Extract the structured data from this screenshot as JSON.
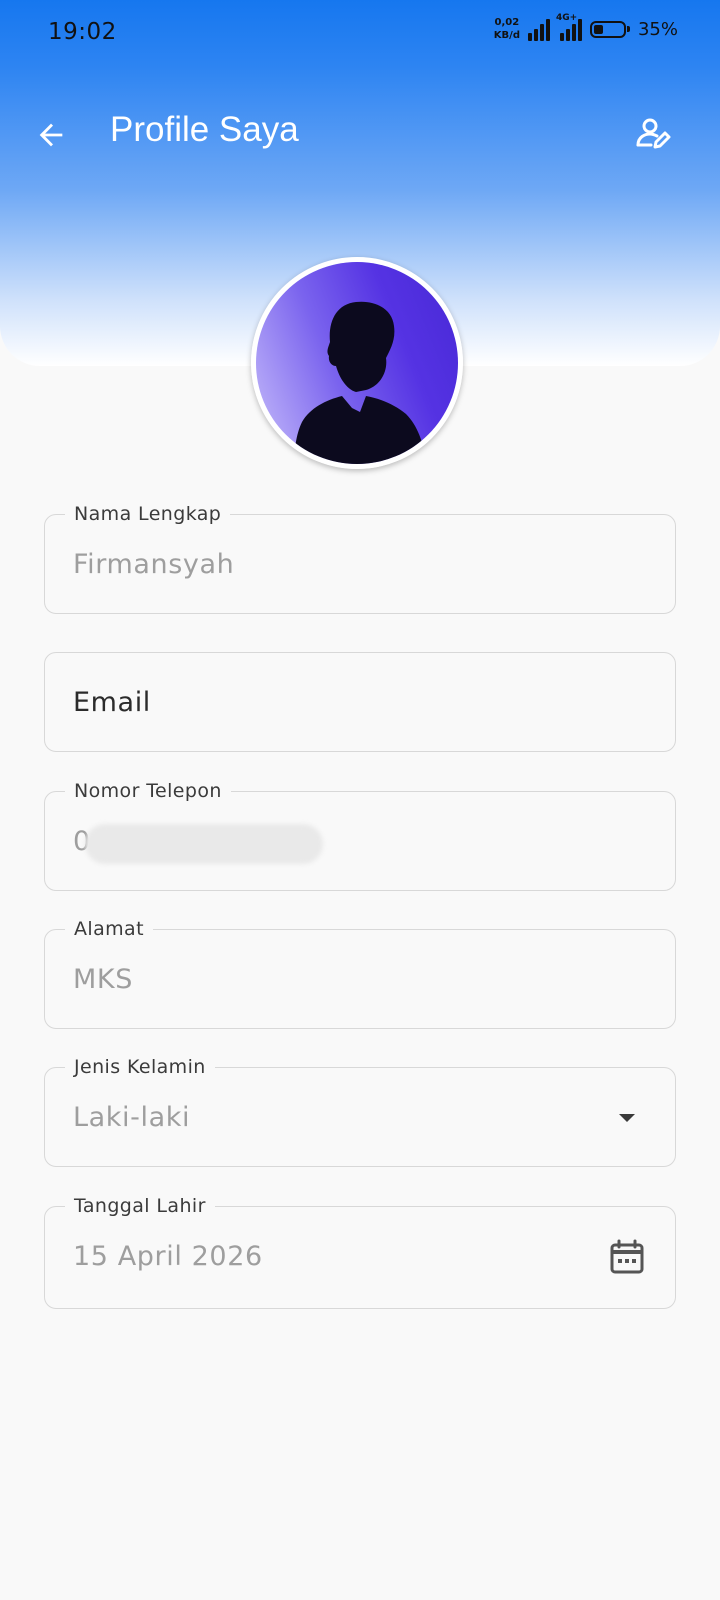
{
  "status_bar": {
    "time": "19:02",
    "net_speed_value": "0,02",
    "net_speed_unit": "KB/d",
    "network_type": "4G+",
    "battery_percent": "35%",
    "battery_level": 0.35,
    "icons": [
      "signal-icon",
      "signal-4g-icon",
      "battery-icon"
    ]
  },
  "app_bar": {
    "title": "Profile Saya",
    "back_icon": "arrow-left-icon",
    "edit_icon": "edit-user-icon"
  },
  "colors": {
    "header_gradient_top": "#1677ef",
    "header_gradient_bottom": "#ffffff",
    "background": "#f9f9f9",
    "field_border": "#d8d8d8",
    "value_text": "#9e9e9e",
    "label_text": "#3b3b3b"
  },
  "form": {
    "full_name": {
      "label": "Nama Lengkap",
      "value": "Firmansyah"
    },
    "email": {
      "placeholder": "Email"
    },
    "phone": {
      "label": "Nomor Telepon",
      "value": "0"
    },
    "address": {
      "label": "Alamat",
      "value": "MKS"
    },
    "gender": {
      "label": "Jenis Kelamin",
      "value": "Laki-laki",
      "icon": "dropdown-arrow-icon"
    },
    "birth_date": {
      "label": "Tanggal Lahir",
      "value": "15 April 2026",
      "icon": "calendar-icon"
    }
  }
}
